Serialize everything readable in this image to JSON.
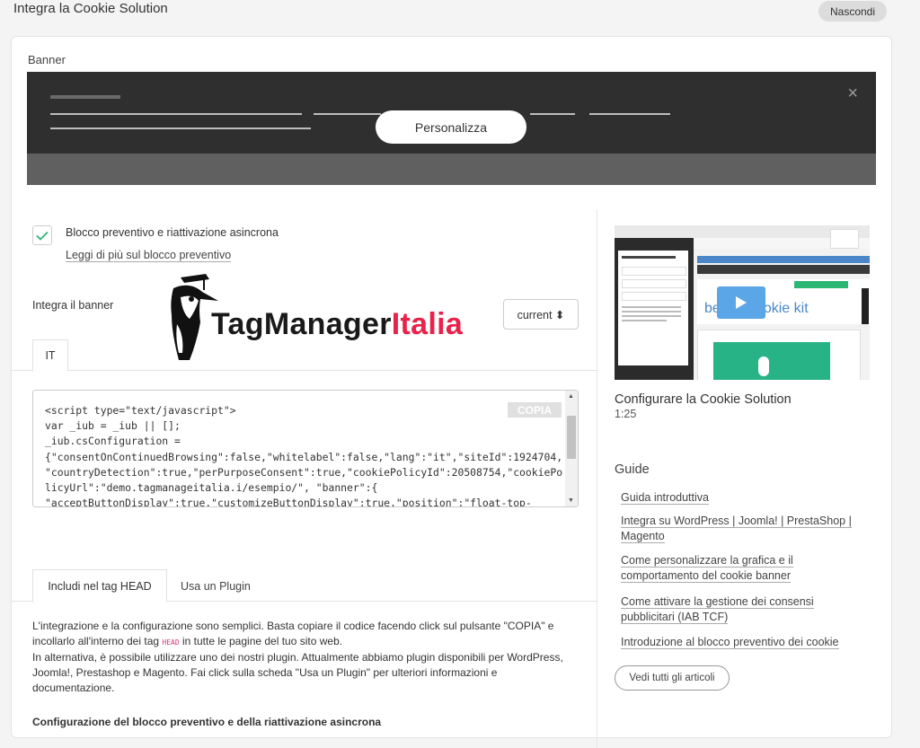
{
  "header": {
    "title": "Integra la Cookie Solution",
    "hide_label": "Nascondi"
  },
  "banner": {
    "section_label": "Banner",
    "customize_label": "Personalizza",
    "close_symbol": "×"
  },
  "blocking": {
    "checked": true,
    "label": "Blocco preventivo e riattivazione asincrona",
    "link": "Leggi di più sul blocco preventivo"
  },
  "integrate": {
    "label": "Integra il banner",
    "version": "current ⬍",
    "tab": "IT",
    "copy_label": "COPIA",
    "code": "<script type=\"text/javascript\">\nvar _iub = _iub || [];\n_iub.csConfiguration =\n{\"consentOnContinuedBrowsing\":false,\"whitelabel\":false,\"lang\":\"it\",\"siteId\":1924704,\n\"countryDetection\":true,\"perPurposeConsent\":true,\"cookiePolicyId\":20508754,\"cookiePo\nlicyUrl\":\"demo.tagmanageitalia.i/esempio/\", \"banner\":{\n\"acceptButtonDisplay\":true,\"customizeButtonDisplay\":true,\"position\":\"float-top-"
  },
  "logo": {
    "text_main": "TagManager",
    "text_accent": "Italia",
    "accent_color": "#e8224a"
  },
  "install_tabs": {
    "head": "Includi nel tag HEAD",
    "plugin": "Usa un Plugin"
  },
  "description": {
    "line1_before": "L'integrazione e la configurazione sono semplici. Basta copiare il codice facendo click sul pulsante \"COPIA\" e incollarlo all'interno dei tag ",
    "head_tag": "HEAD",
    "line1_after": " in tutte le pagine del tuo sito web.",
    "line2": "In alternativa, è possibile utilizzare uno dei nostri plugin. Attualmente abbiamo plugin disponibili per WordPress, Joomla!, Prestashop e Magento. Fai click sulla scheda \"Usa un Plugin\" per ulteriori informazioni e documentazione.",
    "cut_heading": "Configurazione del blocco preventivo e della riattivazione asincrona"
  },
  "video": {
    "title": "Configurare la Cookie Solution",
    "duration": "1:25",
    "inner_text": "benda cookie kit"
  },
  "guide": {
    "title": "Guide",
    "links": [
      "Guida introduttiva",
      "Integra su WordPress | Joomla! | PrestaShop | Magento",
      "Come personalizzare la grafica e il comportamento del cookie banner",
      "Come attivare la gestione dei consensi pubblicitari (IAB TCF)",
      "Introduzione al blocco preventivo dei cookie"
    ],
    "all_label": "Vedi tutti gli articoli"
  },
  "colors": {
    "check": "#2bb673",
    "play": "#5ba6e6"
  }
}
